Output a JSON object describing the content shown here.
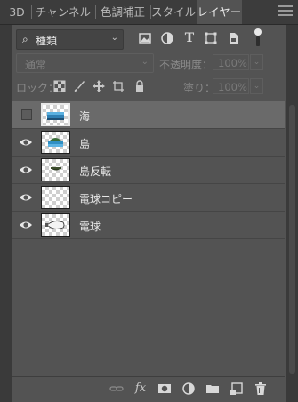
{
  "tabs": [
    "3D",
    "チャンネル",
    "色調補正",
    "スタイル",
    "レイヤー"
  ],
  "active_tab": "レイヤー",
  "filter": {
    "kind_label": "種類"
  },
  "blend_mode": "通常",
  "opacity": {
    "label": "不透明度：",
    "value": "100%"
  },
  "lock": {
    "label": "ロック："
  },
  "fill": {
    "label": "塗り：",
    "value": "100%"
  },
  "layers": [
    {
      "name": "海",
      "visible": false,
      "selected": true
    },
    {
      "name": "島",
      "visible": true,
      "selected": false
    },
    {
      "name": "島反転",
      "visible": true,
      "selected": false
    },
    {
      "name": "電球コピー",
      "visible": true,
      "selected": false
    },
    {
      "name": "電球",
      "visible": true,
      "selected": false
    }
  ],
  "bottom_icons": [
    "link-icon",
    "fx-icon",
    "mask-icon",
    "adjustment-icon",
    "folder-icon",
    "new-layer-icon",
    "trash-icon"
  ],
  "colors": {
    "panel": "#535353",
    "tabbar": "#3c3c3c",
    "selected_row": "#6a6a6a",
    "text": "#e6e6e6",
    "dim_text": "#8a8a8a"
  }
}
